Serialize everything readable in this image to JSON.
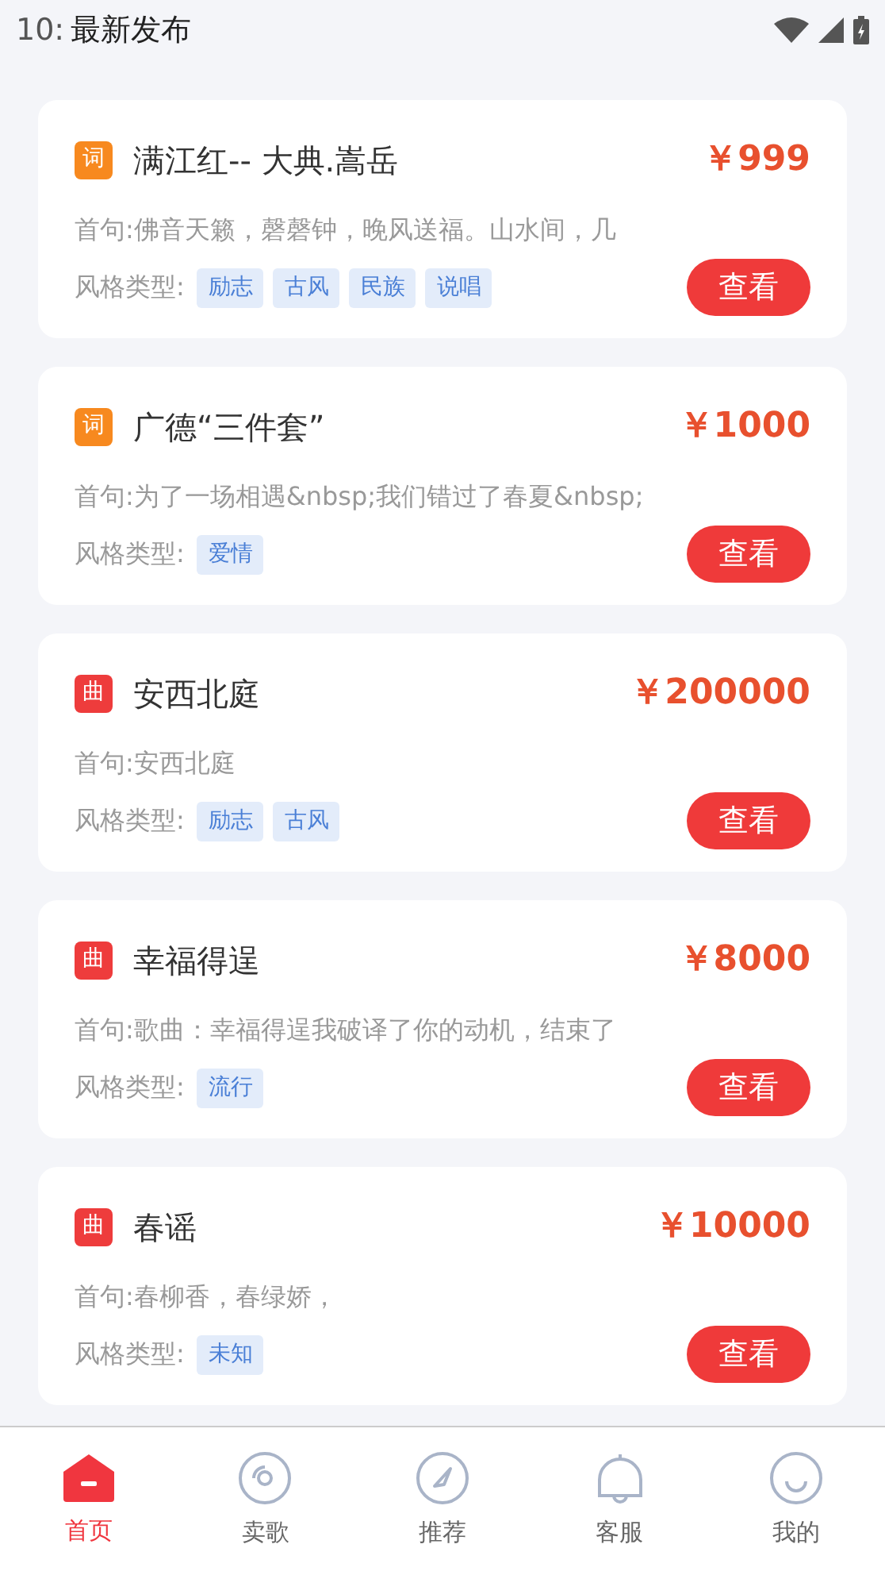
{
  "status_bar": {
    "time": "10:"
  },
  "header": {
    "title": "最新发布"
  },
  "cards": [
    {
      "kind": "ci",
      "badge": "词",
      "title": "满江红-- 大典.嵩岳",
      "price": "￥999",
      "first_line": "首句:佛音天籁，磬磬钟，晚风送福。山水间，几",
      "style_label": "风格类型:",
      "tags": [
        "励志",
        "古风",
        "民族",
        "说唱"
      ],
      "button": "查看"
    },
    {
      "kind": "ci",
      "badge": "词",
      "title": "广德“三件套”",
      "price": "￥1000",
      "first_line": "首句:为了一场相遇&nbsp;我们错过了春夏&nbsp;",
      "style_label": "风格类型:",
      "tags": [
        "爱情"
      ],
      "button": "查看"
    },
    {
      "kind": "qu",
      "badge": "曲",
      "title": "安西北庭",
      "price": "￥200000",
      "first_line": "首句:安西北庭",
      "style_label": "风格类型:",
      "tags": [
        "励志",
        "古风"
      ],
      "button": "查看"
    },
    {
      "kind": "qu",
      "badge": "曲",
      "title": "幸福得逞",
      "price": "￥8000",
      "first_line": "首句:歌曲：幸福得逞我破译了你的动机，结束了",
      "style_label": "风格类型:",
      "tags": [
        "流行"
      ],
      "button": "查看"
    },
    {
      "kind": "qu",
      "badge": "曲",
      "title": "春谣",
      "price": "￥10000",
      "first_line": "首句:春柳香，春绿娇，",
      "style_label": "风格类型:",
      "tags": [
        "未知"
      ],
      "button": "查看"
    }
  ],
  "tab_bar": [
    {
      "kind": "home",
      "label": "首页",
      "selected": true
    },
    {
      "kind": "disc",
      "label": "卖歌",
      "selected": false
    },
    {
      "kind": "compass",
      "label": "推荐",
      "selected": false
    },
    {
      "kind": "bell",
      "label": "客服",
      "selected": false
    },
    {
      "kind": "smile",
      "label": "我的",
      "selected": false
    }
  ]
}
